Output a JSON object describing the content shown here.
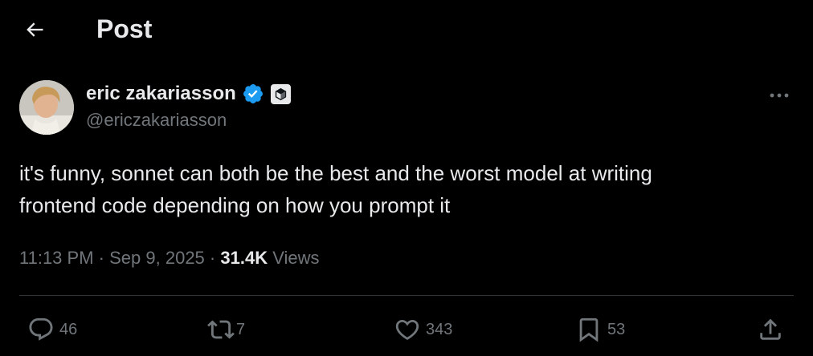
{
  "header": {
    "title": "Post",
    "back_icon": "arrow-left-icon"
  },
  "post": {
    "author": {
      "display_name": "eric zakariasson",
      "handle": "@ericzakariasson",
      "verified": true,
      "verified_color": "#1d9bf0",
      "affiliate_badge_icon": "cursor-logo-icon"
    },
    "text": "it's funny, sonnet can both be the best and the worst model at writing\nfrontend code depending on how you prompt it",
    "time": "11:13 PM",
    "date": "Sep 9, 2025",
    "separator": "·",
    "views_count": "31.4K",
    "views_label": "Views"
  },
  "actions": {
    "replies": {
      "icon": "reply-icon",
      "count": "46"
    },
    "reposts": {
      "icon": "repost-icon",
      "count": "7"
    },
    "likes": {
      "icon": "heart-icon",
      "count": "343"
    },
    "bookmarks": {
      "icon": "bookmark-icon",
      "count": "53"
    },
    "share": {
      "icon": "share-icon"
    }
  },
  "colors": {
    "background": "#000000",
    "primary_text": "#e7e9ea",
    "secondary_text": "#71767b",
    "divider": "#2f3336"
  }
}
